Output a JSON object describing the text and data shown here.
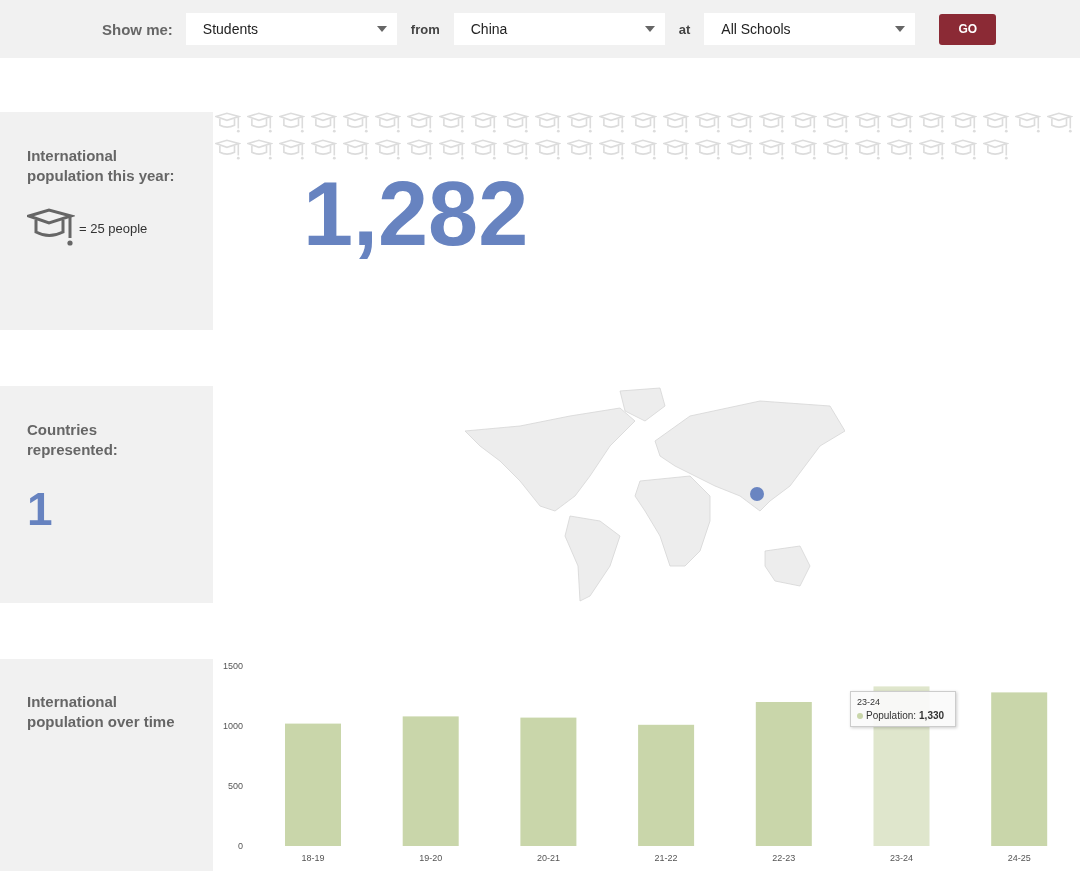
{
  "filter_bar": {
    "show_label": "Show me:",
    "show_value": "Students",
    "from_label": "from",
    "from_value": "China",
    "at_label": "at",
    "at_value": "All Schools",
    "go_button": "GO"
  },
  "population": {
    "title": "International population this year:",
    "legend": "= 25 people",
    "value": "1,282"
  },
  "countries": {
    "title": "Countries represented:",
    "value": "1"
  },
  "over_time": {
    "title": "International population over time",
    "chart_data": {
      "type": "bar",
      "categories": [
        "18-19",
        "19-20",
        "20-21",
        "21-22",
        "22-23",
        "23-24",
        "24-25"
      ],
      "series": [
        {
          "color": "#c9d6aa",
          "values": [
            1020,
            1080,
            1070,
            1010,
            1200,
            1330,
            1280
          ]
        }
      ],
      "ylim": [
        0,
        1500
      ],
      "yticks": [
        0,
        500,
        1000,
        1500
      ]
    },
    "tooltip": {
      "title": "23-24",
      "label": "Population:",
      "value": "1,330"
    }
  }
}
